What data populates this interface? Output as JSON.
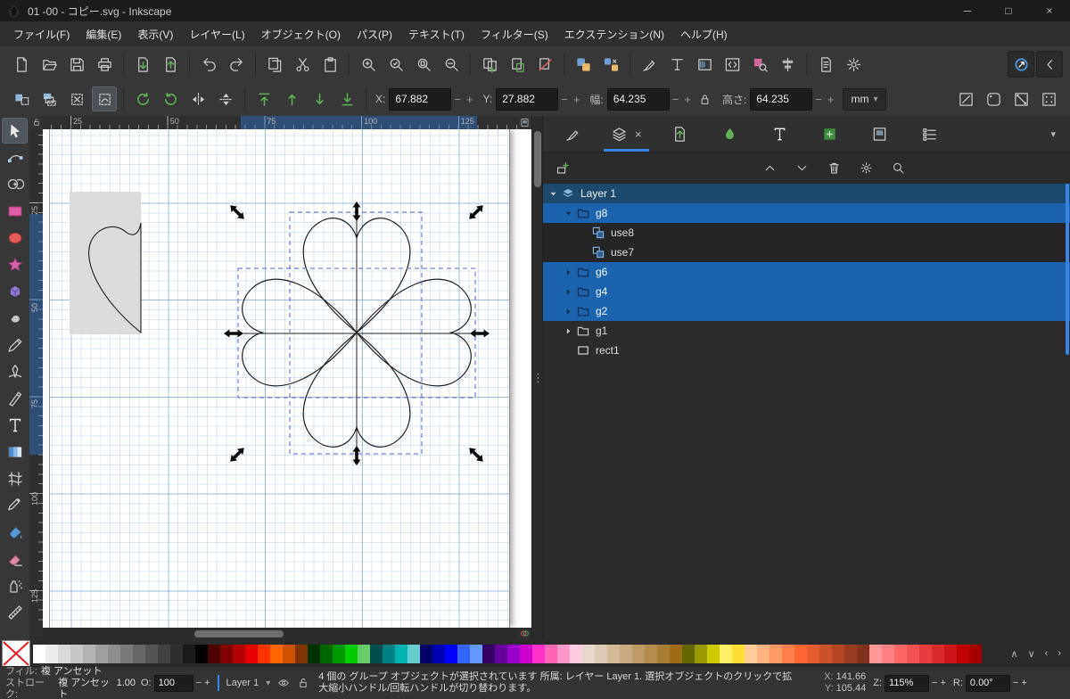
{
  "window": {
    "title": "01 -00 - コピー.svg - Inkscape",
    "controls": {
      "minimize": "─",
      "maximize": "□",
      "close": "×"
    }
  },
  "menubar": {
    "items": [
      "ファイル(F)",
      "編集(E)",
      "表示(V)",
      "レイヤー(L)",
      "オブジェクト(O)",
      "パス(P)",
      "テキスト(T)",
      "フィルター(S)",
      "エクステンション(N)",
      "ヘルプ(H)"
    ]
  },
  "command_toolbar": {
    "groups": [
      {
        "icons": [
          "document-new",
          "document-open",
          "document-save",
          "print"
        ]
      },
      {
        "icons": [
          "import",
          "export"
        ]
      },
      {
        "icons": [
          "undo",
          "redo"
        ]
      },
      {
        "icons": [
          "copy",
          "cut",
          "paste"
        ]
      },
      {
        "icons": [
          "zoom-selection",
          "zoom-drawing",
          "zoom-page",
          "zoom-page-width"
        ]
      },
      {
        "icons": [
          "duplicate",
          "create-clone",
          "unlink-clone"
        ]
      },
      {
        "icons": [
          "group",
          "ungroup"
        ]
      },
      {
        "icons": [
          "fill-stroke-dialog",
          "text-dialog",
          "gradient-dialog",
          "xml-editor",
          "find-replace",
          "align-distribute"
        ]
      },
      {
        "icons": [
          "document-properties",
          "preferences"
        ]
      }
    ],
    "right_icons": [
      "snap-controls",
      "snap-collapse"
    ]
  },
  "tool_controls": {
    "selection_icons": [
      "select-all",
      "select-in-all-layers",
      "deselect",
      "touch-selection"
    ],
    "pressed_icon": "touch-selection",
    "transform_icons": [
      "rotate-ccw",
      "rotate-cw",
      "flip-horizontal",
      "flip-vertical"
    ],
    "zorder_icons": [
      "raise-to-top",
      "raise",
      "lower",
      "lower-to-bottom"
    ],
    "fields": [
      {
        "id": "x",
        "label": "X:",
        "value": "67.882"
      },
      {
        "id": "y",
        "label": "Y:",
        "value": "27.882"
      },
      {
        "id": "w",
        "label": "幅:",
        "value": "64.235"
      },
      {
        "id": "h",
        "label": "高さ:",
        "value": "64.235"
      }
    ],
    "unit": {
      "value": "mm"
    },
    "toggle_icons": [
      "scale-stroke-width",
      "scale-corners",
      "transform-gradients",
      "transform-patterns"
    ]
  },
  "toolbox": {
    "tools": [
      {
        "name": "selector",
        "active": true
      },
      {
        "name": "node"
      },
      {
        "name": "shape-builder"
      },
      {
        "name": "rectangle"
      },
      {
        "name": "ellipse"
      },
      {
        "name": "star"
      },
      {
        "name": "box3d"
      },
      {
        "name": "spiral"
      },
      {
        "name": "pencil"
      },
      {
        "name": "pen"
      },
      {
        "name": "calligraphy"
      },
      {
        "name": "text"
      },
      {
        "name": "gradient"
      },
      {
        "name": "mesh"
      },
      {
        "name": "dropper"
      },
      {
        "name": "bucket"
      },
      {
        "name": "eraser"
      },
      {
        "name": "spray"
      },
      {
        "name": "measure"
      }
    ]
  },
  "rulers": {
    "horizontal": [
      "25",
      "50",
      "75",
      "100",
      "125"
    ],
    "vertical": [
      "25",
      "50",
      "75",
      "100",
      "125"
    ]
  },
  "layers_panel": {
    "tabs": [
      {
        "name": "fill-stroke"
      },
      {
        "name": "objects",
        "active": true,
        "close": "×"
      },
      {
        "name": "export"
      },
      {
        "name": "paint-servers"
      },
      {
        "name": "text"
      },
      {
        "name": "symbols"
      },
      {
        "name": "document"
      },
      {
        "name": "objects-list"
      }
    ],
    "chevron": "▾",
    "toolbar": {
      "left_icons": [
        "new-item"
      ],
      "right_icons": [
        "move-up",
        "move-down",
        "delete",
        "settings",
        "search"
      ]
    },
    "rows": [
      {
        "label": "Layer 1",
        "depth": 0,
        "icon": "layer",
        "caret": "down",
        "state": "layer"
      },
      {
        "label": "g8",
        "depth": 1,
        "icon": "group",
        "caret": "down",
        "state": "sel"
      },
      {
        "label": "use8",
        "depth": 2,
        "icon": "use",
        "caret": "none",
        "state": "child"
      },
      {
        "label": "use7",
        "depth": 2,
        "icon": "use",
        "caret": "none",
        "state": "child"
      },
      {
        "label": "g6",
        "depth": 1,
        "icon": "group",
        "caret": "right",
        "state": "sel"
      },
      {
        "label": "g4",
        "depth": 1,
        "icon": "group",
        "caret": "right",
        "state": "sel"
      },
      {
        "label": "g2",
        "depth": 1,
        "icon": "group",
        "caret": "right",
        "state": "sel"
      },
      {
        "label": "g1",
        "depth": 1,
        "icon": "group",
        "caret": "right",
        "state": "normal"
      },
      {
        "label": "rect1",
        "depth": 1,
        "icon": "rect",
        "caret": "none",
        "state": "normal"
      }
    ]
  },
  "palette": {
    "colors": [
      "#ffffff",
      "#ececec",
      "#d9d9d9",
      "#c6c6c6",
      "#b3b3b3",
      "#a0a0a0",
      "#8d8d8d",
      "#7a7a7a",
      "#676767",
      "#545454",
      "#414141",
      "#2e2e2e",
      "#1b1b1b",
      "#000000",
      "#4d0000",
      "#800000",
      "#b30000",
      "#e60000",
      "#ff3300",
      "#ff6600",
      "#cc5200",
      "#803300",
      "#003300",
      "#006600",
      "#009900",
      "#00cc00",
      "#66cc66",
      "#004d4d",
      "#008080",
      "#00b3b3",
      "#66cccc",
      "#000066",
      "#0000b3",
      "#0000ff",
      "#3366ff",
      "#6699ff",
      "#330066",
      "#660099",
      "#9900cc",
      "#cc00cc",
      "#ff33cc",
      "#ff66b3",
      "#ff99cc",
      "#ffcce0",
      "#e6d9cc",
      "#dcc9b3",
      "#d2ba99",
      "#c8aa80",
      "#bd9b66",
      "#b38b4d",
      "#a97c33",
      "#9f6c1a",
      "#666600",
      "#999900",
      "#cccc00",
      "#ffee66",
      "#ffdd33",
      "#ffcc99",
      "#ffb380",
      "#ff9966",
      "#ff804d",
      "#ff6633",
      "#e65c2e",
      "#cc5229",
      "#b34724",
      "#993d1f",
      "#80331a",
      "#ff9999",
      "#ff8080",
      "#ff6666",
      "#f25252",
      "#e63e3e",
      "#d92b2b",
      "#cc1717",
      "#bf0303",
      "#a60000"
    ]
  },
  "palette_controls": {
    "up": "∧",
    "down": "∨",
    "prev": "‹",
    "next": "›"
  },
  "statusbar": {
    "fill_label": "フィル:",
    "fill_value": "複 アンセット",
    "stroke_label": "ストローク:",
    "stroke_value": "複 アンセット",
    "stroke_width": "1.00",
    "opacity_label": "O:",
    "opacity_value": "100",
    "layer_name": "Layer 1",
    "message": "4 個の グループ オブジェクトが選択されています 所属: レイヤー Layer 1. 選択オブジェクトのクリックで拡大縮小ハンドル/回転ハンドルが切り替わります。",
    "x_label": "X:",
    "x_value": "141.66",
    "y_label": "Y:",
    "y_value": "105.44",
    "zoom_label": "Z:",
    "zoom_value": "115%",
    "rotation_label": "R:",
    "rotation_value": "0.00°",
    "stepper_minus": "−",
    "stepper_plus": "+"
  },
  "colors": {
    "accent": "#3584e4",
    "selected_row": "#1b63ad",
    "current_layer_row": "#1c4a6e",
    "grid_major": "#5894c8",
    "grid_minor": "#78afdc",
    "selection_dash": "#5f5fd3"
  }
}
